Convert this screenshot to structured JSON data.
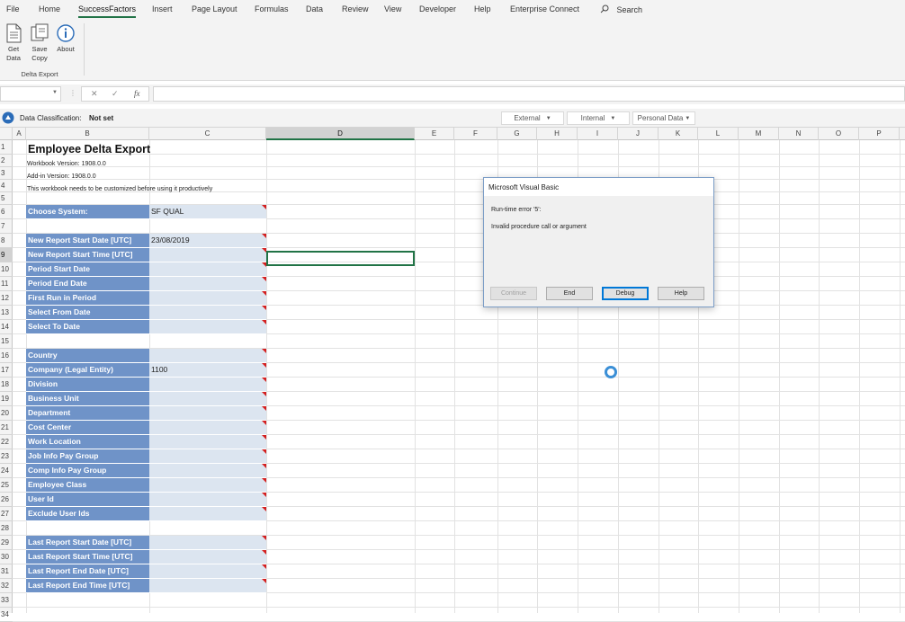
{
  "ribbon": {
    "tabs": [
      "File",
      "Home",
      "SuccessFactors",
      "Insert",
      "Page Layout",
      "Formulas",
      "Data",
      "Review",
      "View",
      "Developer",
      "Help",
      "Enterprise Connect"
    ],
    "active_tab": "SuccessFactors",
    "search_label": "Search",
    "buttons": [
      {
        "line1": "Get",
        "line2": "Data"
      },
      {
        "line1": "Save",
        "line2": "Copy"
      },
      {
        "line1": "About",
        "line2": ""
      }
    ],
    "group_label": "Delta Export"
  },
  "formula_bar": {
    "name_box": "",
    "fx_label": "fx",
    "formula": ""
  },
  "classification": {
    "label": "Data Classification:",
    "value": "Not set",
    "dropdowns": [
      "External",
      "Internal",
      "Personal Data"
    ]
  },
  "columns": [
    "A",
    "B",
    "C",
    "D",
    "E",
    "F",
    "G",
    "H",
    "I",
    "J",
    "K",
    "L",
    "M",
    "N",
    "O",
    "P"
  ],
  "selected_column": "D",
  "selected_row": "9",
  "sheet": {
    "title": "Employee Delta Export",
    "workbook_version": "Workbook Version: 1908.0.0",
    "addin_version": "Add-in Version: 1908.0.0",
    "note": "This workbook needs to be customized before using it productively",
    "fields": [
      {
        "row": 6,
        "label": "Choose System:",
        "value": "SF QUAL"
      },
      {
        "row": 8,
        "label": "New Report Start Date [UTC]",
        "value": "23/08/2019"
      },
      {
        "row": 9,
        "label": "New Report Start Time [UTC]",
        "value": ""
      },
      {
        "row": 10,
        "label": "Period Start Date",
        "value": ""
      },
      {
        "row": 11,
        "label": "Period End Date",
        "value": ""
      },
      {
        "row": 12,
        "label": "First Run in Period",
        "value": ""
      },
      {
        "row": 13,
        "label": "Select From Date",
        "value": ""
      },
      {
        "row": 14,
        "label": "Select To Date",
        "value": ""
      },
      {
        "row": 16,
        "label": "Country",
        "value": ""
      },
      {
        "row": 17,
        "label": "Company (Legal Entity)",
        "value": "1100"
      },
      {
        "row": 18,
        "label": "Division",
        "value": ""
      },
      {
        "row": 19,
        "label": "Business Unit",
        "value": ""
      },
      {
        "row": 20,
        "label": "Department",
        "value": ""
      },
      {
        "row": 21,
        "label": "Cost Center",
        "value": ""
      },
      {
        "row": 22,
        "label": "Work Location",
        "value": ""
      },
      {
        "row": 23,
        "label": "Job Info Pay Group",
        "value": ""
      },
      {
        "row": 24,
        "label": "Comp Info Pay Group",
        "value": ""
      },
      {
        "row": 25,
        "label": "Employee Class",
        "value": ""
      },
      {
        "row": 26,
        "label": "User Id",
        "value": ""
      },
      {
        "row": 27,
        "label": "Exclude User Ids",
        "value": ""
      },
      {
        "row": 29,
        "label": "Last Report Start Date [UTC]",
        "value": ""
      },
      {
        "row": 30,
        "label": "Last Report Start Time [UTC]",
        "value": ""
      },
      {
        "row": 31,
        "label": "Last Report End Date [UTC]",
        "value": ""
      },
      {
        "row": 32,
        "label": "Last Report End Time [UTC]",
        "value": ""
      }
    ]
  },
  "dialog": {
    "title": "Microsoft Visual Basic",
    "error": "Run-time error '5':",
    "message": "Invalid procedure call or argument",
    "buttons": {
      "continue": "Continue",
      "end": "End",
      "debug": "Debug",
      "help": "Help"
    }
  },
  "colors": {
    "label_bg": "#6f93c8",
    "value_bg": "#dce5f0",
    "accent": "#217346"
  }
}
